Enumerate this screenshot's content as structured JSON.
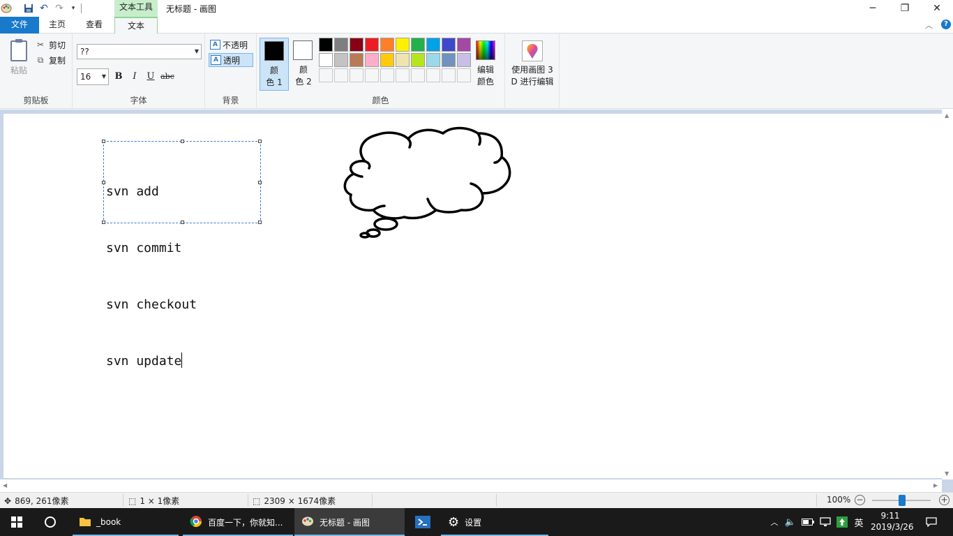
{
  "window": {
    "title": "无标题 - 画图",
    "context_tab": "文本工具",
    "controls": {
      "minimize": "─",
      "restore": "❐",
      "close": "✕"
    }
  },
  "ribbon_tabs": [
    "文件",
    "主页",
    "查看",
    "文本"
  ],
  "ribbon_minimize": "︿",
  "help": "?",
  "clipboard": {
    "paste": "粘贴",
    "cut": "剪切",
    "copy": "复制",
    "group_label": "剪贴板"
  },
  "font": {
    "family_value": "??",
    "size_value": "16",
    "bold": "B",
    "italic": "I",
    "underline": "U",
    "strike": "abc",
    "group_label": "字体"
  },
  "background": {
    "opaque": "不透明",
    "transparent": "透明",
    "icon_letter": "A",
    "group_label": "背景"
  },
  "colors": {
    "color1_label": "颜\n色 1",
    "color2_label": "颜\n色 2",
    "edit_colors": "编辑\n颜色",
    "group_label": "颜色",
    "color1": "#000000",
    "color2": "#ffffff",
    "palette_row1": [
      "#000000",
      "#7f7f7f",
      "#880015",
      "#ed1c24",
      "#ff7f27",
      "#fff200",
      "#22b14c",
      "#00a2e8",
      "#3f48cc",
      "#a349a4"
    ],
    "palette_row2": [
      "#ffffff",
      "#c3c3c3",
      "#b97a57",
      "#ffaec9",
      "#ffc90e",
      "#efe4b0",
      "#b5e61d",
      "#99d9ea",
      "#7092be",
      "#c8bfe7"
    ],
    "palette_row3": [
      "#f5f6f7",
      "#f5f6f7",
      "#f5f6f7",
      "#f5f6f7",
      "#f5f6f7",
      "#f5f6f7",
      "#f5f6f7",
      "#f5f6f7",
      "#f5f6f7",
      "#f5f6f7"
    ]
  },
  "paint3d": {
    "label": "使用画图 3\nD 进行编辑"
  },
  "canvas": {
    "text_lines": [
      "svn add",
      "svn commit",
      "svn checkout",
      "svn update"
    ]
  },
  "status": {
    "cursor_pos": "869, 261像素",
    "selection_size": "1 × 1像素",
    "image_size": "2309 × 1674像素",
    "zoom": "100%",
    "zoom_minus": "−",
    "zoom_plus": "+"
  },
  "taskbar": {
    "items": [
      "_book",
      "百度一下，你就知...",
      "无标题 - 画图",
      "设置"
    ],
    "ime": "英",
    "time": "9:11",
    "date": "2019/3/26"
  }
}
